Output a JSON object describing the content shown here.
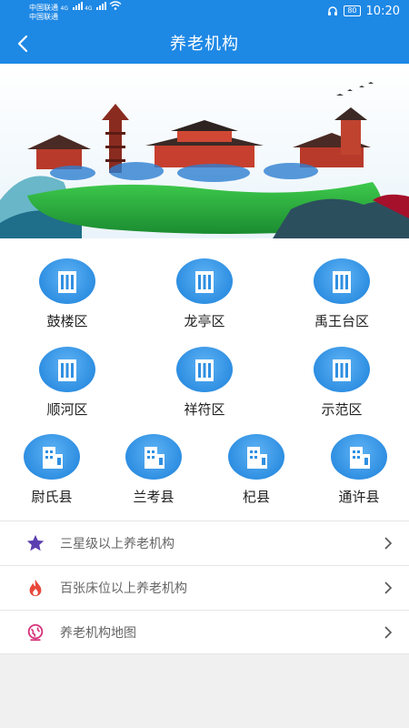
{
  "status_bar": {
    "carrier1": "中国联通",
    "carrier2": "中国联通",
    "net1": "4G",
    "net2": "4G",
    "battery": "80",
    "time": "10:20"
  },
  "header": {
    "title": "养老机构"
  },
  "districts": [
    {
      "label": "鼓楼区"
    },
    {
      "label": "龙亭区"
    },
    {
      "label": "禹王台区"
    },
    {
      "label": "顺河区"
    },
    {
      "label": "祥符区"
    },
    {
      "label": "示范区"
    },
    {
      "label": "尉氏县"
    },
    {
      "label": "兰考县"
    },
    {
      "label": "杞县"
    },
    {
      "label": "通许县"
    }
  ],
  "menu": [
    {
      "label": "三星级以上养老机构",
      "icon": "star-icon",
      "color": "#5b3fb0"
    },
    {
      "label": "百张床位以上养老机构",
      "icon": "flame-icon",
      "color": "#e8483b"
    },
    {
      "label": "养老机构地图",
      "icon": "globe-icon",
      "color": "#d6337a"
    }
  ],
  "colors": {
    "primary": "#1e88e5",
    "icon_blue": "#2f8fe2",
    "background": "#f0f0f0"
  }
}
